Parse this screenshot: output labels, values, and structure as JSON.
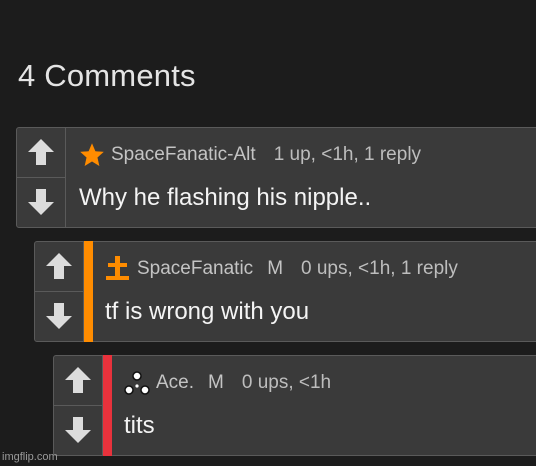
{
  "heading": "4 Comments",
  "colors": {
    "background": "#1c1c1c",
    "card": "#3a3a3a",
    "accent_orange": "#ff8c00",
    "accent_red": "#e8323c",
    "star": "#ff8c00"
  },
  "comments": [
    {
      "user": "SpaceFanatic-Alt",
      "mod": "",
      "stats": "1 up, <1h, 1 reply",
      "text": "Why he flashing his nipple..",
      "badge_icon": "star-icon"
    },
    {
      "user": "SpaceFanatic",
      "mod": "M",
      "stats": "0 ups, <1h, 1 reply",
      "text": "tf is wrong with you",
      "badge_icon": "mod-cross-icon"
    },
    {
      "user": "Ace.",
      "mod": "M",
      "stats": "0 ups, <1h",
      "text": "tits",
      "badge_icon": "triangle-dots-icon"
    }
  ],
  "watermark": "imgflip.com"
}
